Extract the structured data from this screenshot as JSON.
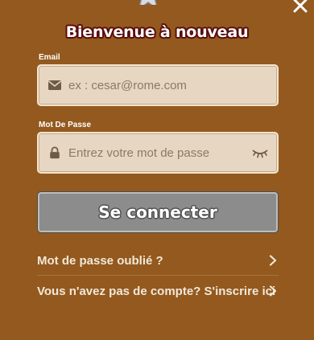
{
  "title": "Bienvenue à nouveau",
  "email": {
    "label": "Email",
    "placeholder": "ex : cesar@rome.com",
    "value": ""
  },
  "password": {
    "label": "Mot De Passe",
    "placeholder": "Entrez votre mot de passe",
    "value": ""
  },
  "login_button": "Se connecter",
  "links": {
    "forgot_password": "Mot de passe oublié ?",
    "signup": "Vous n'avez pas de compte? S'inscrire ici"
  },
  "icons": {
    "star": "star-icon",
    "close": "close-icon",
    "email": "envelope-icon",
    "password": "lock-icon",
    "visibility": "eye-closed-icon",
    "chevron": "chevron-right-icon"
  },
  "colors": {
    "background": "#93591e",
    "field_bg": "#e6d6c2",
    "button_bg": "#8c8c8c",
    "title_outline": "#5a0d0d"
  }
}
